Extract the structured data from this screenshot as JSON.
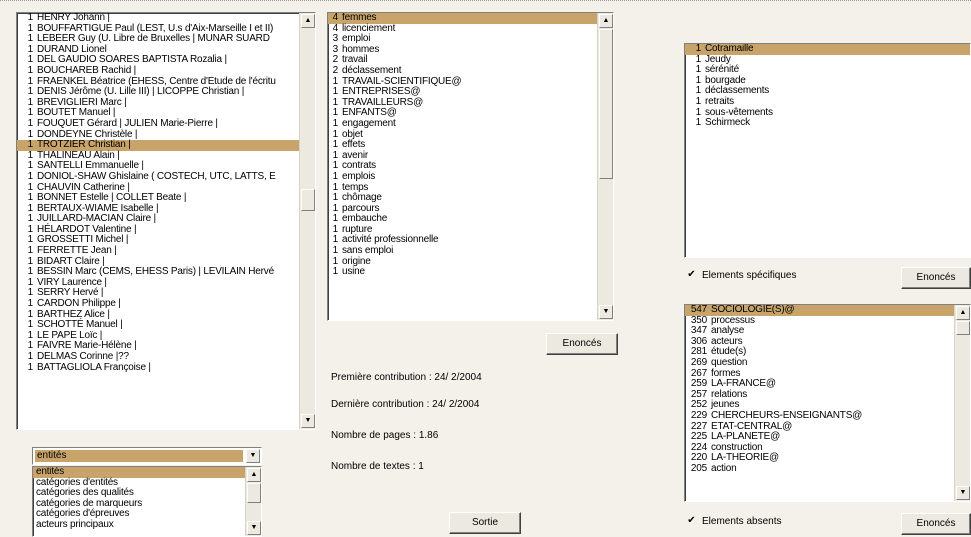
{
  "authors": [
    {
      "count": "1",
      "text": "HENRY Johann  |"
    },
    {
      "count": "1",
      "text": "BOUFFARTIGUE Paul (LEST, U.s d'Aix-Marseille I et II)"
    },
    {
      "count": "1",
      "text": "LEBEER Guy (U. Libre de Bruxelles  | MUNAR SUARD"
    },
    {
      "count": "1",
      "text": "DURAND Lionel"
    },
    {
      "count": "1",
      "text": "DEL GAUDIO SOARES BAPTISTA Rozalia  |"
    },
    {
      "count": "1",
      "text": "BOUCHAREB Rachid  |"
    },
    {
      "count": "1",
      "text": "FRAENKEL Béatrice (EHESS, Centre d'Etude de l'écritu"
    },
    {
      "count": "1",
      "text": "DENIS Jérôme (U. Lille III)  | LICOPPE Christian  |"
    },
    {
      "count": "1",
      "text": "BREVIGLIERI Marc  |"
    },
    {
      "count": "1",
      "text": "BOUTET Manuel  |"
    },
    {
      "count": "1",
      "text": "FOUQUET Gérard  | JULIEN Marie-Pierre  |"
    },
    {
      "count": "1",
      "text": "DONDEYNE Christèle  |"
    },
    {
      "count": "1",
      "text": "TROTZIER Christian  |",
      "selected": true
    },
    {
      "count": "1",
      "text": "THALINEAU Alain  |"
    },
    {
      "count": "1",
      "text": "SANTELLI Emmanuelle  |"
    },
    {
      "count": "1",
      "text": "DONIOL-SHAW Ghislaine ( COSTECH, UTC, LATTS, E"
    },
    {
      "count": "1",
      "text": "CHAUVIN Catherine  |"
    },
    {
      "count": "1",
      "text": "BONNET Estelle  | COLLET Beate  |"
    },
    {
      "count": "1",
      "text": "BERTAUX-WIAME Isabelle  |"
    },
    {
      "count": "1",
      "text": "JUILLARD-MACIAN Claire  |"
    },
    {
      "count": "1",
      "text": "HÉLARDOT Valentine  |"
    },
    {
      "count": "1",
      "text": "GROSSETTI Michel  |"
    },
    {
      "count": "1",
      "text": "FERRETTE Jean  |"
    },
    {
      "count": "1",
      "text": "BIDART Claire  |"
    },
    {
      "count": "1",
      "text": "BESSIN Marc (CEMS, EHESS Paris)  | LEVILAIN Hervé"
    },
    {
      "count": "1",
      "text": "VIRY Laurence  |"
    },
    {
      "count": "1",
      "text": "SERRY Hervé  |"
    },
    {
      "count": "1",
      "text": "CARDON Philippe  |"
    },
    {
      "count": "1",
      "text": "BARTHEZ Alice  |"
    },
    {
      "count": "1",
      "text": "SCHOTTÉ Manuel  |"
    },
    {
      "count": "1",
      "text": "LE PAPE Loïc  |"
    },
    {
      "count": "1",
      "text": "FAIVRE Marie-Hélène  |"
    },
    {
      "count": "1",
      "text": "DELMAS Corinne  |??"
    },
    {
      "count": "1",
      "text": "BATTAGLIOLA Françoise  |"
    }
  ],
  "words": [
    {
      "count": "4",
      "text": "femmes",
      "selected": true
    },
    {
      "count": "4",
      "text": "licenciement"
    },
    {
      "count": "3",
      "text": "emploi"
    },
    {
      "count": "3",
      "text": "hommes"
    },
    {
      "count": "2",
      "text": "travail"
    },
    {
      "count": "2",
      "text": "déclassement"
    },
    {
      "count": "1",
      "text": "TRAVAIL-SCIENTIFIQUE@"
    },
    {
      "count": "1",
      "text": "ENTREPRISES@"
    },
    {
      "count": "1",
      "text": "TRAVAILLEURS@"
    },
    {
      "count": "1",
      "text": "ENFANTS@"
    },
    {
      "count": "1",
      "text": "engagement"
    },
    {
      "count": "1",
      "text": "objet"
    },
    {
      "count": "1",
      "text": "effets"
    },
    {
      "count": "1",
      "text": "avenir"
    },
    {
      "count": "1",
      "text": "contrats"
    },
    {
      "count": "1",
      "text": "emplois"
    },
    {
      "count": "1",
      "text": "temps"
    },
    {
      "count": "1",
      "text": "chômage"
    },
    {
      "count": "1",
      "text": "parcours"
    },
    {
      "count": "1",
      "text": "embauche"
    },
    {
      "count": "1",
      "text": "rupture"
    },
    {
      "count": "1",
      "text": "activité professionnelle"
    },
    {
      "count": "1",
      "text": "sans emploi"
    },
    {
      "count": "1",
      "text": "origine"
    },
    {
      "count": "1",
      "text": "usine"
    }
  ],
  "specific": [
    {
      "count": "1",
      "text": "Cotramaille",
      "selected": true
    },
    {
      "count": "1",
      "text": "Jeudy"
    },
    {
      "count": "1",
      "text": "sérénité"
    },
    {
      "count": "1",
      "text": "bourgade"
    },
    {
      "count": "1",
      "text": "déclassements"
    },
    {
      "count": "1",
      "text": "retraits"
    },
    {
      "count": "1",
      "text": "sous-vêtements"
    },
    {
      "count": "1",
      "text": "Schirmeck"
    }
  ],
  "absent": [
    {
      "count": "547",
      "text": "SOCIOLOGIE(S)@",
      "selected": true
    },
    {
      "count": "350",
      "text": "processus"
    },
    {
      "count": "347",
      "text": "analyse"
    },
    {
      "count": "306",
      "text": "acteurs"
    },
    {
      "count": "281",
      "text": "étude(s)"
    },
    {
      "count": "269",
      "text": "question"
    },
    {
      "count": "267",
      "text": "formes"
    },
    {
      "count": "259",
      "text": "LA-FRANCE@"
    },
    {
      "count": "257",
      "text": "relations"
    },
    {
      "count": "252",
      "text": "jeunes"
    },
    {
      "count": "229",
      "text": "CHERCHEURS-ENSEIGNANTS@"
    },
    {
      "count": "227",
      "text": "ETAT-CENTRAL@"
    },
    {
      "count": "225",
      "text": "LA-PLANETE@"
    },
    {
      "count": "224",
      "text": "construction"
    },
    {
      "count": "220",
      "text": "LA-THEORIE@"
    },
    {
      "count": "205",
      "text": "action"
    }
  ],
  "category_combo": {
    "value": "entités"
  },
  "category_options": [
    {
      "text": "entités",
      "selected": true
    },
    {
      "text": "catégories d'entités"
    },
    {
      "text": "catégories des qualités"
    },
    {
      "text": "catégories de marqueurs"
    },
    {
      "text": "catégories d'épreuves"
    },
    {
      "text": "acteurs principaux"
    }
  ],
  "info": {
    "first_contribution": "Première contribution : 24/ 2/2004",
    "last_contribution": "Dernière contribution : 24/ 2/2004",
    "pages": "Nombre de pages :  1.86",
    "texts": "Nombre de textes : 1"
  },
  "buttons": {
    "enonces_words": "Enoncés",
    "enonces_specific": "Enoncés",
    "enonces_absent": "Enoncés",
    "sortie": "Sortie"
  },
  "checkboxes": {
    "specific_label": "Elements spécifiques",
    "absent_label": "Elements absents",
    "specific_checked": true,
    "absent_checked": true
  },
  "colors": {
    "selection": "#c8a46a",
    "window_bg": "#f4f1ea"
  }
}
